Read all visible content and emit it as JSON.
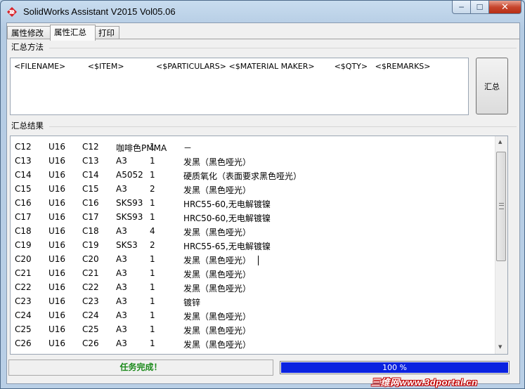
{
  "window": {
    "title": "SolidWorks Assistant V2015 Vol05.06",
    "minimize_label": "─",
    "maximize_label": "☐",
    "close_label": "✕",
    "icon": "solidworks-logo-icon"
  },
  "tabs": [
    {
      "label": "属性修改",
      "active": false
    },
    {
      "label": "属性汇总",
      "active": true
    },
    {
      "label": "打印",
      "active": false
    }
  ],
  "summary_method": {
    "label": "汇总方法",
    "formula": "<FILENAME>         <$ITEM>             <$PARTICULARS> <$MATERIAL MAKER>        <$QTY>   <$REMARKS>",
    "button_label": "汇总"
  },
  "results": {
    "label": "汇总结果",
    "rows": [
      [
        "C12",
        "U16",
        "C12",
        "咖啡色PMMA",
        "1",
        "－"
      ],
      [
        "C13",
        "U16",
        "C13",
        "A3",
        "1",
        "发黑（黑色哑光）"
      ],
      [
        "C14",
        "U16",
        "C14",
        "A5052",
        "1",
        "硬质氧化（表面要求黑色哑光）"
      ],
      [
        "C15",
        "U16",
        "C15",
        "A3",
        "2",
        "发黑（黑色哑光）"
      ],
      [
        "C16",
        "U16",
        "C16",
        "SKS93",
        "1",
        "HRC55-60,无电解镀镍"
      ],
      [
        "C17",
        "U16",
        "C17",
        "SKS93",
        "1",
        "HRC50-60,无电解镀镍"
      ],
      [
        "C18",
        "U16",
        "C18",
        "A3",
        "4",
        "发黑（黑色哑光）"
      ],
      [
        "C19",
        "U16",
        "C19",
        "SKS3",
        "2",
        "HRC55-65,无电解镀镍"
      ],
      [
        "C20",
        "U16",
        "C20",
        "A3",
        "1",
        "发黑（黑色哑光）"
      ],
      [
        "C21",
        "U16",
        "C21",
        "A3",
        "1",
        "发黑（黑色哑光）"
      ],
      [
        "C22",
        "U16",
        "C22",
        "A3",
        "1",
        "发黑（黑色哑光）"
      ],
      [
        "C23",
        "U16",
        "C23",
        "A3",
        "1",
        "镀锌"
      ],
      [
        "C24",
        "U16",
        "C24",
        "A3",
        "1",
        "发黑（黑色哑光）"
      ],
      [
        "C25",
        "U16",
        "C25",
        "A3",
        "1",
        "发黑（黑色哑光）"
      ],
      [
        "C26",
        "U16",
        "C26",
        "A3",
        "1",
        "发黑（黑色哑光）"
      ]
    ]
  },
  "status": {
    "message": "任务完成！",
    "progress_percent": 100,
    "progress_label": "100 %"
  },
  "watermark": "三维网www.3dportal.cn",
  "colors": {
    "status_green": "#1b8a1b",
    "progress_blue": "#0a22e0",
    "close_red": "#c7462e"
  }
}
